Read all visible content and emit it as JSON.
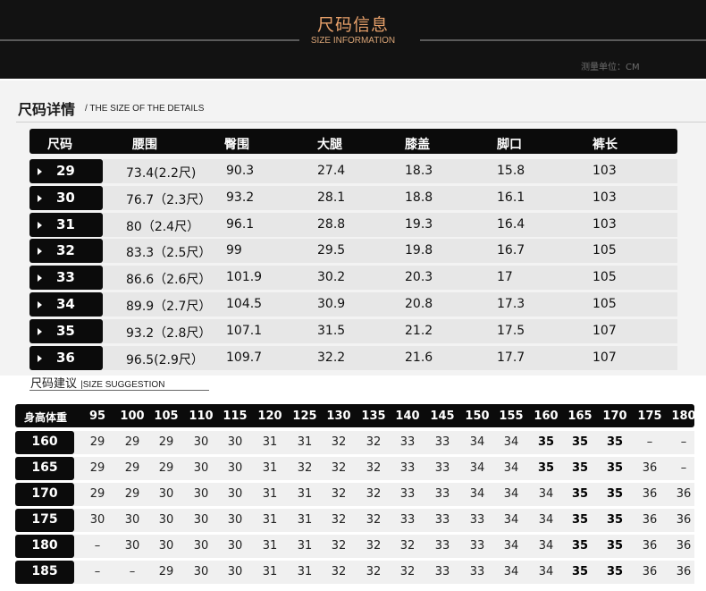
{
  "header": {
    "title": "尺码信息",
    "subtitle": "SIZE INFORMATION",
    "unit": "测量单位：CM"
  },
  "details": {
    "title": "尺码详情",
    "subtitle": "/ THE SIZE OF THE DETAILS",
    "columns": [
      "尺码",
      "腰围",
      "臀围",
      "大腿",
      "膝盖",
      "脚口",
      "裤长"
    ],
    "rows": [
      [
        "29",
        "73.4(2.2尺)",
        "90.3",
        "27.4",
        "18.3",
        "15.8",
        "103"
      ],
      [
        "30",
        "76.7（2.3尺）",
        "93.2",
        "28.1",
        "18.8",
        "16.1",
        "103"
      ],
      [
        "31",
        "80（2.4尺）",
        "96.1",
        "28.8",
        "19.3",
        "16.4",
        "103"
      ],
      [
        "32",
        "83.3（2.5尺）",
        "99",
        "29.5",
        "19.8",
        "16.7",
        "105"
      ],
      [
        "33",
        "86.6（2.6尺）",
        "101.9",
        "30.2",
        "20.3",
        "17",
        "105"
      ],
      [
        "34",
        "89.9（2.7尺）",
        "104.5",
        "30.9",
        "20.8",
        "17.3",
        "105"
      ],
      [
        "35",
        "93.2（2.8尺）",
        "107.1",
        "31.5",
        "21.2",
        "17.5",
        "107"
      ],
      [
        "36",
        "96.5(2.9尺）",
        "109.7",
        "32.2",
        "21.6",
        "17.7",
        "107"
      ]
    ]
  },
  "suggestion": {
    "title": "尺码建议",
    "subtitle": "|SIZE SUGGESTION",
    "corner_label": "身高体重",
    "weights": [
      "95",
      "100",
      "105",
      "110",
      "115",
      "120",
      "125",
      "130",
      "135",
      "140",
      "145",
      "150",
      "155",
      "160",
      "165",
      "170",
      "175",
      "180"
    ],
    "rows": [
      {
        "height": "160",
        "values": [
          "29",
          "29",
          "29",
          "30",
          "30",
          "31",
          "31",
          "32",
          "32",
          "33",
          "33",
          "34",
          "34",
          "35",
          "35",
          "35",
          "–",
          "–"
        ]
      },
      {
        "height": "165",
        "values": [
          "29",
          "29",
          "29",
          "30",
          "30",
          "31",
          "32",
          "32",
          "32",
          "33",
          "33",
          "34",
          "34",
          "35",
          "35",
          "35",
          "36",
          "–"
        ]
      },
      {
        "height": "170",
        "values": [
          "29",
          "29",
          "30",
          "30",
          "30",
          "31",
          "31",
          "32",
          "32",
          "33",
          "33",
          "34",
          "34",
          "34",
          "35",
          "35",
          "36",
          "36"
        ]
      },
      {
        "height": "175",
        "values": [
          "30",
          "30",
          "30",
          "30",
          "30",
          "31",
          "31",
          "32",
          "32",
          "33",
          "33",
          "33",
          "34",
          "34",
          "35",
          "35",
          "36",
          "36"
        ]
      },
      {
        "height": "180",
        "values": [
          "–",
          "30",
          "30",
          "30",
          "30",
          "31",
          "31",
          "32",
          "32",
          "32",
          "33",
          "33",
          "34",
          "34",
          "35",
          "35",
          "36",
          "36"
        ]
      },
      {
        "height": "185",
        "values": [
          "–",
          "–",
          "29",
          "30",
          "30",
          "31",
          "31",
          "32",
          "32",
          "32",
          "33",
          "33",
          "34",
          "34",
          "35",
          "35",
          "36",
          "36"
        ]
      }
    ]
  }
}
